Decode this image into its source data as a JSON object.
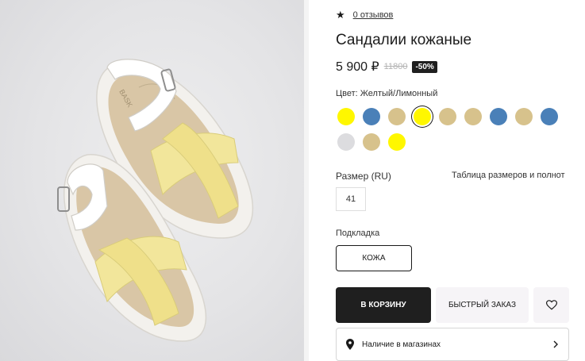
{
  "product": {
    "rating_icon": "star-icon",
    "reviews_text": "0 отзывов",
    "title": "Сандалии кожаные",
    "price_now": "5 900 ₽",
    "price_old": "11800",
    "discount": "-50%",
    "color_label": "Цвет: Желтый/Лимонный"
  },
  "swatches": [
    {
      "color": "#fff700",
      "selected": false
    },
    {
      "color": "#4a80b8",
      "selected": false
    },
    {
      "color": "#d7c28c",
      "selected": false
    },
    {
      "color": "#fff700",
      "selected": true
    },
    {
      "color": "#d7c28c",
      "selected": false
    },
    {
      "color": "#d7c28c",
      "selected": false
    },
    {
      "color": "#4a80b8",
      "selected": false
    },
    {
      "color": "#d7c28c",
      "selected": false
    },
    {
      "color": "#4a80b8",
      "selected": false
    },
    {
      "color": "#dcdcdf",
      "selected": false
    },
    {
      "color": "#d7c28c",
      "selected": false
    },
    {
      "color": "#fff700",
      "selected": false
    }
  ],
  "size": {
    "label": "Размер (RU)",
    "table_link": "Таблица размеров и полнот",
    "selected": "41"
  },
  "lining": {
    "label": "Подкладка",
    "selected": "КОЖА"
  },
  "actions": {
    "cart_label": "В КОРЗИНУ",
    "quick_order_label": "БЫСТРЫЙ ЗАКАЗ",
    "favorite_icon": "heart-icon"
  },
  "stores": {
    "label": "Наличие в магазинах",
    "pin_icon": "location-pin-icon",
    "chevron_icon": "chevron-right-icon"
  }
}
